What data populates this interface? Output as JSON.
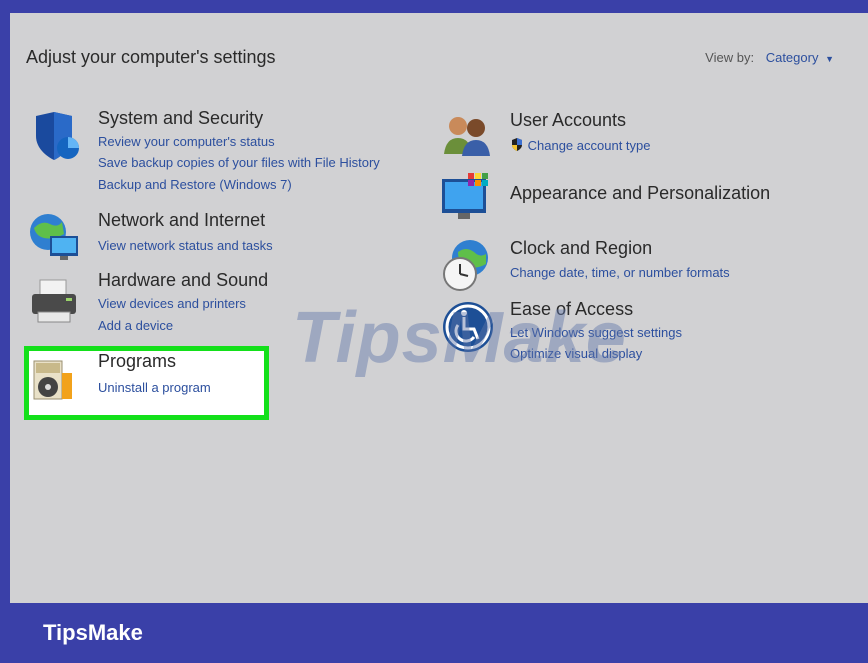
{
  "header": {
    "title": "Adjust your computer's settings",
    "view_by_label": "View by:",
    "view_by_value": "Category"
  },
  "left_categories": [
    {
      "title": "System and Security",
      "icon": "shield-icon",
      "links": [
        "Review your computer's status",
        "Save backup copies of your files with File History",
        "Backup and Restore (Windows 7)"
      ]
    },
    {
      "title": "Network and Internet",
      "icon": "network-globe-icon",
      "links": [
        "View network status and tasks"
      ]
    },
    {
      "title": "Hardware and Sound",
      "icon": "printer-icon",
      "links": [
        "View devices and printers",
        "Add a device"
      ]
    },
    {
      "title": "Programs",
      "icon": "programs-disc-icon",
      "links": [
        "Uninstall a program"
      ]
    }
  ],
  "right_categories": [
    {
      "title": "User Accounts",
      "icon": "users-icon",
      "links": [
        "Change account type"
      ]
    },
    {
      "title": "Appearance and Personalization",
      "icon": "monitor-palette-icon",
      "links": []
    },
    {
      "title": "Clock and Region",
      "icon": "clock-globe-icon",
      "links": [
        "Change date, time, or number formats"
      ]
    },
    {
      "title": "Ease of Access",
      "icon": "ease-of-access-icon",
      "links": [
        "Let Windows suggest settings",
        "Optimize visual display"
      ]
    }
  ],
  "highlight_color": "#13e01a",
  "link_color": "#2c4f9e",
  "watermark_text": "TipsMake",
  "footer": {
    "brand": "TipsMake"
  }
}
